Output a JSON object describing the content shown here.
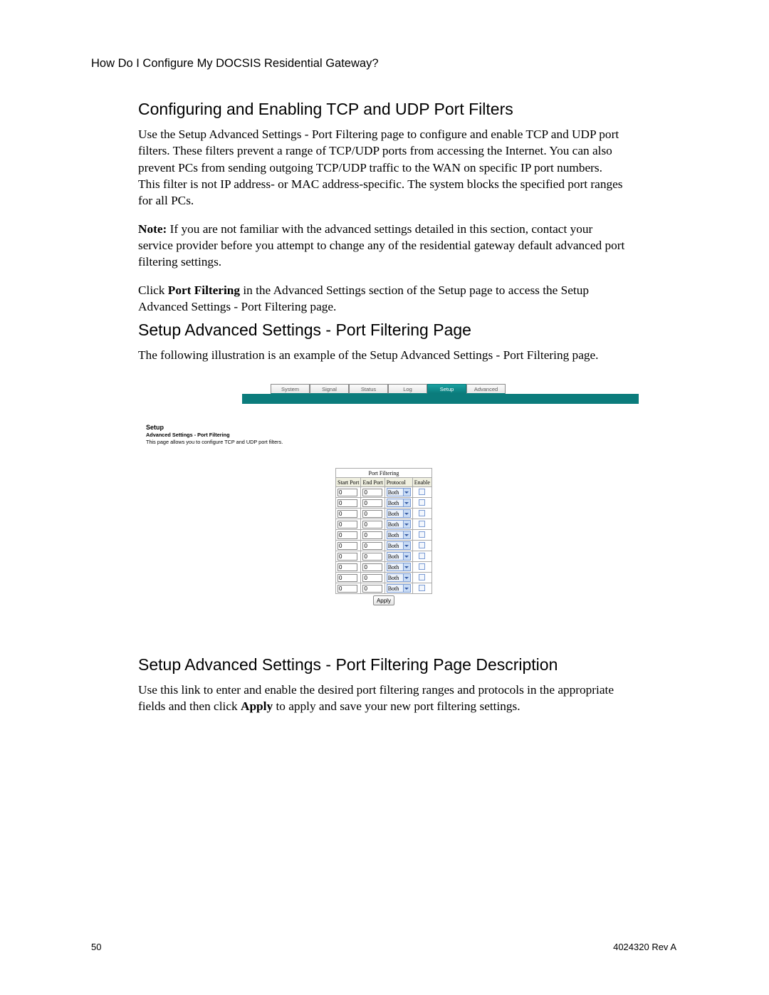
{
  "header": "How Do I Configure My DOCSIS Residential Gateway?",
  "s1": {
    "h": "Configuring and Enabling TCP and UDP Port Filters",
    "p1": "Use the Setup Advanced Settings - Port Filtering page to configure and enable TCP and UDP port filters. These filters prevent a range of TCP/UDP ports from accessing the Internet. You can also prevent PCs from sending outgoing TCP/UDP traffic to the WAN on specific IP port numbers. This filter is not IP address- or MAC address-specific. The system blocks the specified port ranges for all PCs.",
    "note_label": "Note:",
    "note_rest": " If you are not familiar with the advanced settings detailed in this section, contact your service provider before you attempt to change any of the residential gateway default advanced port filtering settings.",
    "p3a": "Click ",
    "p3b": "Port Filtering",
    "p3c": " in the Advanced Settings section of the Setup page to access the Setup Advanced Settings - Port Filtering page."
  },
  "s2": {
    "h": "Setup Advanced Settings - Port Filtering Page",
    "p": "The following illustration is an example of the Setup Advanced Settings - Port Filtering page."
  },
  "illust": {
    "tabs": [
      "System",
      "Signal",
      "Status",
      "Log",
      "Setup",
      "Advanced"
    ],
    "active_tab_index": 4,
    "title1": "Setup",
    "title2": "Advanced Settings - Port Filtering",
    "title3": "This page allows you to configure TCP and UDP port filters.",
    "table_caption": "Port Filtering",
    "cols": [
      "Start Port",
      "End Port",
      "Protocol",
      "Enable"
    ],
    "proto_value": "Both",
    "port_value": "0",
    "rows": 10,
    "apply": "Apply"
  },
  "s3": {
    "h": "Setup Advanced Settings - Port Filtering Page Description",
    "p_a": "Use this link to enter and enable the desired port filtering ranges and protocols in the appropriate fields and then click ",
    "p_b": "Apply",
    "p_c": " to apply and save your new port filtering settings."
  },
  "pageno": "50",
  "docid": "4024320 Rev A"
}
